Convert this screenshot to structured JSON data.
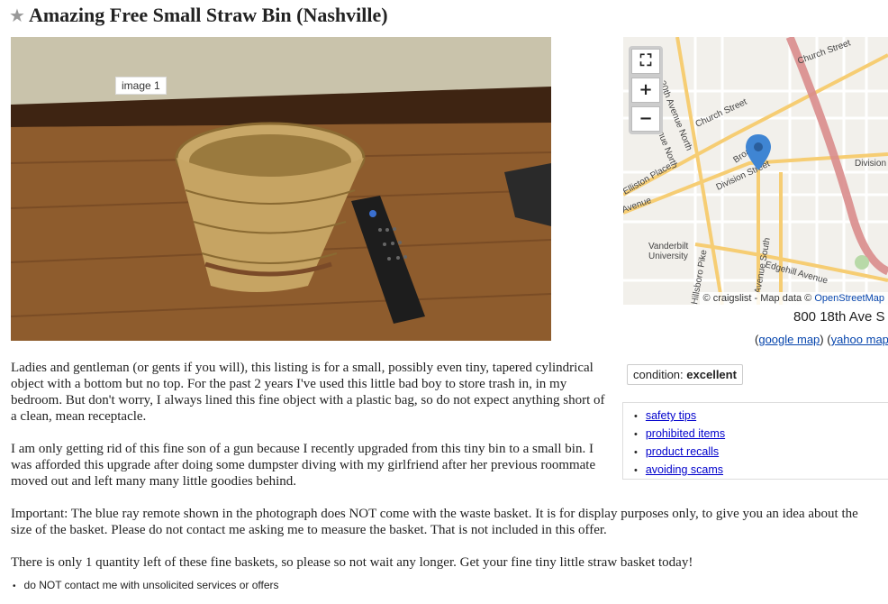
{
  "posting": {
    "title": "Amazing Free Small Straw Bin (Nashville)",
    "star_icon": "star-icon"
  },
  "photo": {
    "label": "image 1"
  },
  "map": {
    "controls": {
      "fullscreen_icon": "fullscreen-icon",
      "zoom_in": "+",
      "zoom_out": "−"
    },
    "streets": [
      "Church Street",
      "Church Street",
      "20th Avenue North",
      "Elliston Place",
      "Avenue North",
      "Division Street",
      "Division",
      "Broadway",
      "Vanderbilt University",
      "Edgehill Avenue",
      "Avenue South",
      "Hillsboro Pike",
      "Avenue"
    ],
    "attribution_prefix": "© craigslist - Map data ©",
    "attribution_link": "OpenStreetMap",
    "address": "800 18th Ave S",
    "google_link": "google map",
    "yahoo_link": "yahoo map",
    "accent": "#4a90d9"
  },
  "attributes": {
    "condition_label": "condition:",
    "condition_value": "excellent"
  },
  "notices": [
    {
      "label": "safety tips"
    },
    {
      "label": "prohibited items"
    },
    {
      "label": "product recalls"
    },
    {
      "label": "avoiding scams"
    }
  ],
  "body": {
    "p1": "Ladies and gentleman (or gents if you will), this listing is for a small, possibly even tiny, tapered cylindrical object with a bottom but no top. For the past 2 years I've used this little bad boy to store trash in, in my bedroom. But don't worry, I always lined this fine object with a plastic bag, so do not expect anything short of a clean, mean receptacle.",
    "p2": "I am only getting rid of this fine son of a gun because I recently upgraded from this tiny bin to a small bin. I was afforded this upgrade after doing some dumpster diving with my girlfriend after her previous roommate moved out and left many many little goodies behind.",
    "p3": "Important: The blue ray remote shown in the photograph does NOT come with the waste basket. It is for display purposes only, to give you an idea about the size of the basket. Please do not contact me asking me to measure the basket. That is not included in this offer.",
    "p4": "There is only 1 quantity left of these fine baskets, so please so not wait any longer. Get your fine tiny little straw basket today!"
  },
  "extra_notes": [
    "do NOT contact me with unsolicited services or offers"
  ]
}
